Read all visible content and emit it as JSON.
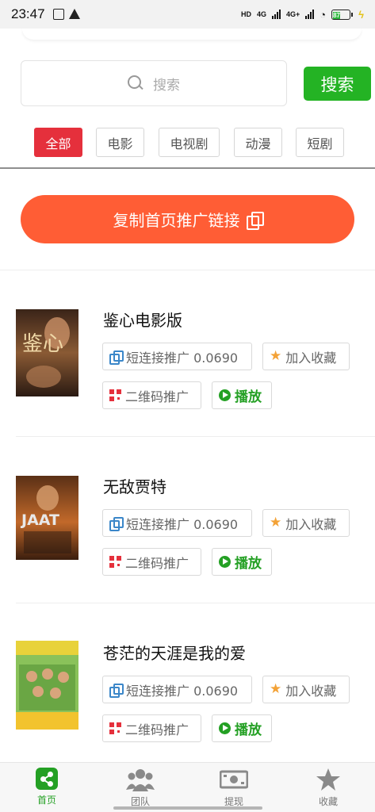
{
  "status_bar": {
    "time": "23:47",
    "network_labels": [
      "HD",
      "4G",
      "4G+"
    ],
    "battery": "87"
  },
  "search": {
    "placeholder": "搜索",
    "button_label": "搜索"
  },
  "tabs": [
    {
      "label": "全部",
      "active": true
    },
    {
      "label": "电影",
      "active": false
    },
    {
      "label": "电视剧",
      "active": false
    },
    {
      "label": "动漫",
      "active": false
    },
    {
      "label": "短剧",
      "active": false
    }
  ],
  "copy_home_label": "复制首页推广链接",
  "movies": [
    {
      "title": "鉴心电影版",
      "short_link_label": "短连接推广 0.0690",
      "favorite_label": "加入收藏",
      "qr_label": "二维码推广",
      "play_label": "播放",
      "poster_text": "鉴心"
    },
    {
      "title": "无敌贾特",
      "short_link_label": "短连接推广 0.0690",
      "favorite_label": "加入收藏",
      "qr_label": "二维码推广",
      "play_label": "播放",
      "poster_text": "JAAT"
    },
    {
      "title": "苍茫的天涯是我的爱",
      "short_link_label": "短连接推广 0.0690",
      "favorite_label": "加入收藏",
      "qr_label": "二维码推广",
      "play_label": "播放",
      "poster_text": ""
    }
  ],
  "bottom_nav": [
    {
      "label": "首页",
      "icon": "share-icon",
      "active": true
    },
    {
      "label": "团队",
      "icon": "team-icon",
      "active": false
    },
    {
      "label": "提现",
      "icon": "cash-icon",
      "active": false
    },
    {
      "label": "收藏",
      "icon": "star-icon",
      "active": false
    }
  ],
  "colors": {
    "accent_green": "#24b324",
    "tab_active_red": "#e5303c",
    "copy_button_orange": "#ff5d35"
  }
}
